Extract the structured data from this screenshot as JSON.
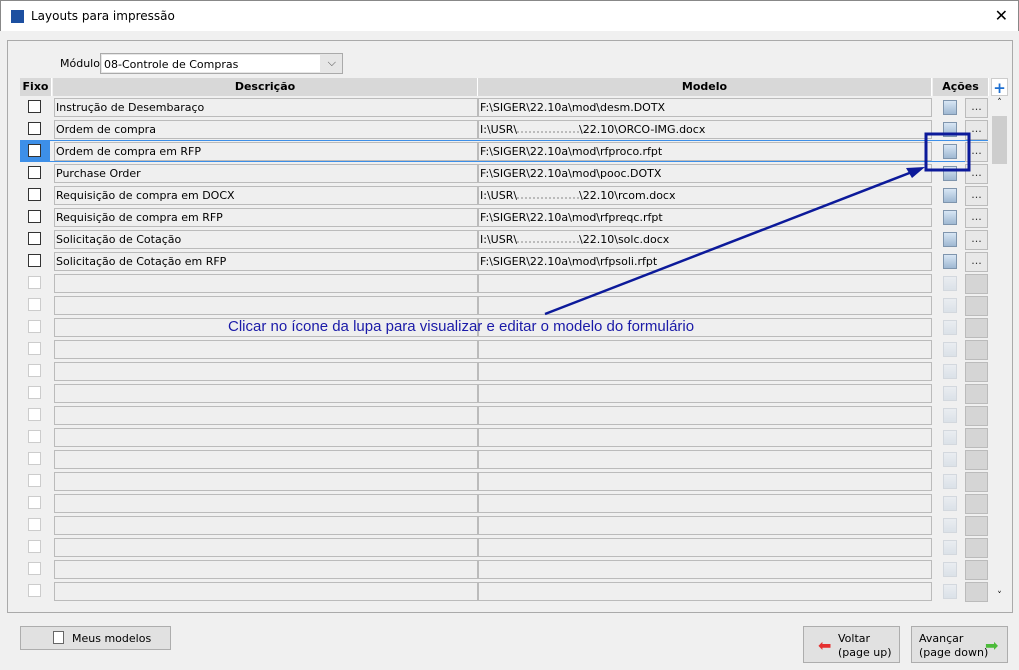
{
  "window": {
    "title": "Layouts para impressão",
    "close_icon": "close-icon"
  },
  "module": {
    "label": "Módulo",
    "value": "08-Controle de Compras"
  },
  "table": {
    "headers": {
      "fixo": "Fixo",
      "descricao": "Descrição",
      "modelo": "Modelo",
      "acoes": "Ações"
    },
    "rows": [
      {
        "descricao": "Instrução de Desembaraço",
        "modelo": "F:\\SIGER\\22.10a\\mod\\desm.DOTX"
      },
      {
        "descricao": "Ordem de compra",
        "modelo_pre": "I:\\USR\\",
        "modelo": "\\22.10\\ORCO-IMG.docx",
        "blurred": true
      },
      {
        "descricao": "Ordem de compra em RFP",
        "modelo": "F:\\SIGER\\22.10a\\mod\\rfproco.rfpt",
        "selected": true
      },
      {
        "descricao": "Purchase Order",
        "modelo": "F:\\SIGER\\22.10a\\mod\\pooc.DOTX"
      },
      {
        "descricao": "Requisição de compra em DOCX",
        "modelo_pre": "I:\\USR\\",
        "modelo": "\\22.10\\rcom.docx",
        "blurred": true
      },
      {
        "descricao": "Requisição de compra em RFP",
        "modelo": "F:\\SIGER\\22.10a\\mod\\rfpreqc.rfpt"
      },
      {
        "descricao": "Solicitação de Cotação",
        "modelo_pre": "I:\\USR\\",
        "modelo": "\\22.10\\solc.docx",
        "blurred": true
      },
      {
        "descricao": "Solicitação de Cotação em RFP",
        "modelo": "F:\\SIGER\\22.10a\\mod\\rfpsoli.rfpt"
      }
    ],
    "empty_rows": 15,
    "dots_label": "..."
  },
  "annotation": {
    "text": "Clicar no ícone da lupa para visualizar e editar o modelo do formulário",
    "color": "#1a1aa8"
  },
  "buttons": {
    "meus_modelos": "Meus modelos",
    "voltar": "Voltar",
    "voltar_sub": "(page up)",
    "avancar": "Avançar",
    "avancar_sub": "(page down)"
  }
}
